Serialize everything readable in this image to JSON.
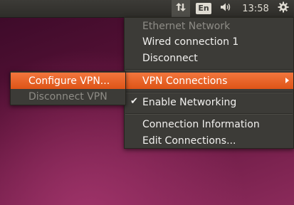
{
  "panel": {
    "network_icon": "network-updown-icon",
    "keyboard_layout": "En",
    "sound_icon": "speaker-volume-icon",
    "clock": "13:58",
    "system_icon": "gear-icon"
  },
  "network_menu": {
    "items": [
      {
        "label": "Ethernet Network",
        "enabled": false
      },
      {
        "label": "Wired connection 1",
        "enabled": true
      },
      {
        "label": "Disconnect",
        "enabled": true
      },
      {
        "label": "VPN Connections",
        "enabled": true,
        "highlighted": true,
        "has_submenu": true
      },
      {
        "label": "Enable Networking",
        "enabled": true,
        "checked": true
      },
      {
        "label": "Connection Information",
        "enabled": true
      },
      {
        "label": "Edit Connections...",
        "enabled": true
      }
    ]
  },
  "vpn_submenu": {
    "items": [
      {
        "label": "Configure VPN...",
        "enabled": true,
        "highlighted": true
      },
      {
        "label": "Disconnect VPN",
        "enabled": false
      }
    ]
  },
  "colors": {
    "panel_bg": "#3c3b37",
    "menu_bg": "#3c3b37",
    "highlight": "#e9662c",
    "text": "#f2f1ef",
    "disabled_text": "#8e8c86"
  }
}
